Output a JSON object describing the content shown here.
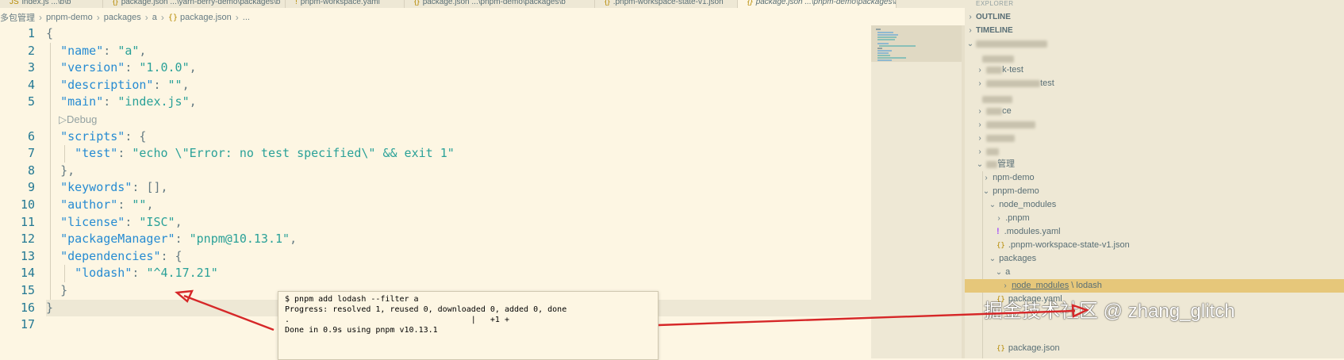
{
  "tabs": [
    {
      "label": "index.js",
      "detail": "...\\b\\b",
      "active": false
    },
    {
      "label": "package.json",
      "detail": "...\\yarn-berry-demo\\packages\\b",
      "active": false
    },
    {
      "label": "pnpm-workspace.yaml",
      "detail": "",
      "active": false
    },
    {
      "label": "package.json",
      "detail": "...\\pnpm-demo\\packages\\b",
      "active": false
    },
    {
      "label": ".pnpm-workspace-state-v1.json",
      "detail": "",
      "active": false
    },
    {
      "label": "package.json",
      "detail": "...\\pnpm-demo\\packages\\a",
      "active": true
    }
  ],
  "breadcrumb": [
    "多包管理",
    "pnpm-demo",
    "packages",
    "a",
    "package.json",
    "..."
  ],
  "editor": {
    "line_numbers": [
      "1",
      "2",
      "3",
      "4",
      "5",
      "6",
      "7",
      "8",
      "9",
      "10",
      "11",
      "12",
      "13",
      "14",
      "15",
      "16",
      "17"
    ],
    "codelens": "Debug",
    "lines": {
      "l1": "{",
      "l2_key": "\"name\"",
      "l2_val": "\"a\"",
      "l3_key": "\"version\"",
      "l3_val": "\"1.0.0\"",
      "l4_key": "\"description\"",
      "l4_val": "\"\"",
      "l5_key": "\"main\"",
      "l5_val": "\"index.js\"",
      "l6_key": "\"scripts\"",
      "l7_key": "\"test\"",
      "l7_val": "\"echo \\\"Error: no test specified\\\" && exit 1\"",
      "l8": "},",
      "l9_key": "\"keywords\"",
      "l9_val": "[],",
      "l10_key": "\"author\"",
      "l10_val": "\"\"",
      "l11_key": "\"license\"",
      "l11_val": "\"ISC\"",
      "l12_key": "\"packageManager\"",
      "l12_val": "\"pnpm@10.13.1\"",
      "l13_key": "\"dependencies\"",
      "l14_key": "\"lodash\"",
      "l14_val": "\"^4.17.21\"",
      "l15": "}",
      "l16": "}"
    }
  },
  "terminal": {
    "lines": [
      "$ pnpm add lodash --filter a",
      "Progress: resolved 1, reused 0, downloaded 0, added 0, done",
      ".                                      |   +1 +",
      "Done in 0.9s using pnpm v10.13.1"
    ]
  },
  "sidebar": {
    "title": "EXPLORER",
    "outline": "OUTLINE",
    "timeline": "TIMELINE",
    "items": {
      "i1": "k-test",
      "i2": "test",
      "i3": "ce",
      "i4": "管理",
      "npm_demo": "npm-demo",
      "pnpm_demo": "pnpm-demo",
      "node_modules": "node_modules",
      "pnpm_dir": ".pnpm",
      "modules_yaml": ".modules.yaml",
      "state_json": ".pnpm-workspace-state-v1.json",
      "packages": "packages",
      "a": "a",
      "a_node_modules": "node_modules",
      "a_lodash": "lodash",
      "package_yaml": "package.yaml",
      "package_json": "package.json"
    }
  },
  "watermark": "掘金技术社区 @ zhang_glitch",
  "colors": {
    "arrow": "#d62728",
    "selection": "#e6c77a",
    "background": "#fdf6e3"
  }
}
